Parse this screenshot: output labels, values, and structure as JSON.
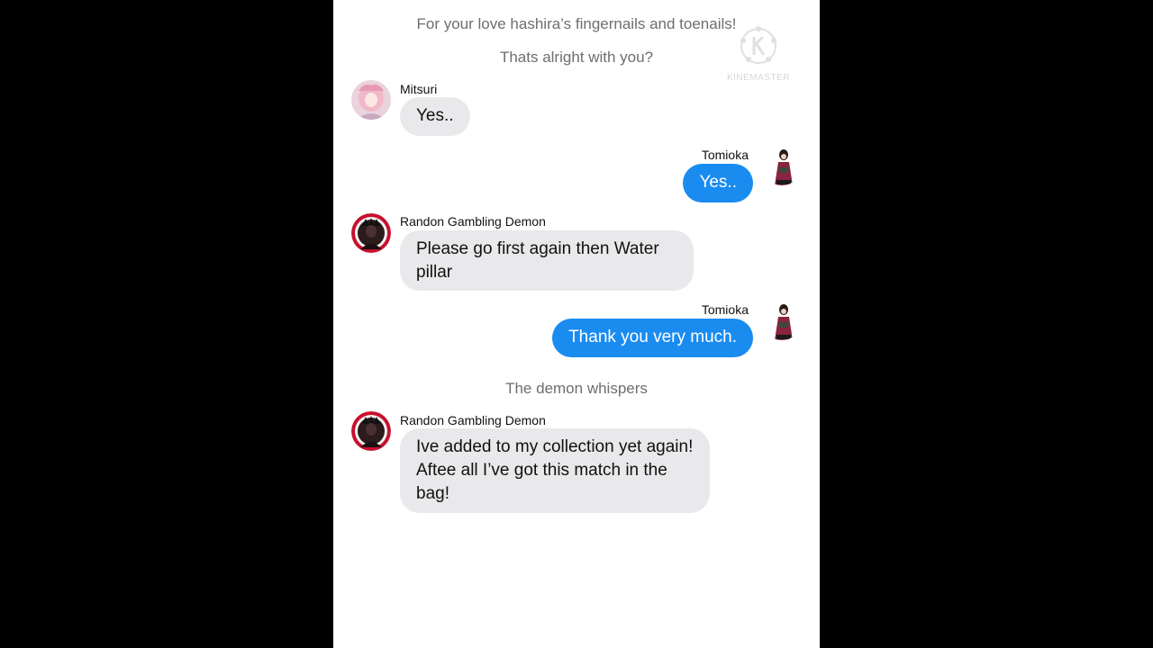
{
  "watermark": {
    "text": "KINEMASTER",
    "icon": "kinemaster-logo"
  },
  "system_messages": [
    "For your love hashira’s fingernails and toenails!",
    "Thats alright with you?",
    "The demon whispers"
  ],
  "messages": [
    {
      "sender": "Mitsuri",
      "text": "Yes..",
      "direction": "incoming",
      "avatar": "mitsuri-avatar"
    },
    {
      "sender": "Tomioka",
      "text": "Yes..",
      "direction": "outgoing",
      "avatar": "tomioka-avatar"
    },
    {
      "sender": "Randon Gambling Demon",
      "text": "Please go first again then Water pillar",
      "direction": "incoming",
      "avatar": "demon-avatar"
    },
    {
      "sender": "Tomioka",
      "text": "Thank you very much.",
      "direction": "outgoing",
      "avatar": "tomioka-avatar"
    },
    {
      "sender": "Randon Gambling Demon",
      "text": "Ive added to my collection yet again! Aftee all I’ve got this match in the bag!",
      "direction": "incoming",
      "avatar": "demon-avatar"
    }
  ],
  "colors": {
    "outgoing_bubble": "#1a8cf0",
    "incoming_bubble": "#e9e9eb",
    "system_text": "#6e6e73",
    "background": "#ffffff",
    "letterbox": "#000000"
  }
}
